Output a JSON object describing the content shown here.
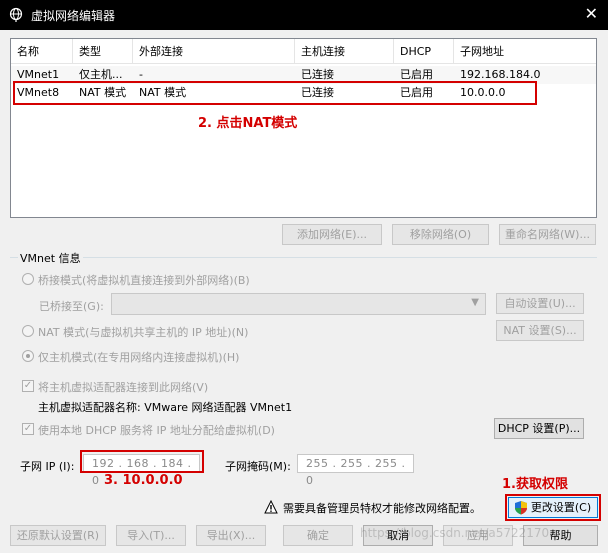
{
  "window": {
    "title": "虚拟网络编辑器",
    "close_glyph": "✕"
  },
  "table": {
    "columns": [
      "名称",
      "类型",
      "外部连接",
      "主机连接",
      "DHCP",
      "子网地址"
    ],
    "rows": [
      [
        "VMnet1",
        "仅主机...",
        "-",
        "已连接",
        "已启用",
        "192.168.184.0"
      ],
      [
        "VMnet8",
        "NAT 模式",
        "NAT 模式",
        "已连接",
        "已启用",
        "10.0.0.0"
      ]
    ]
  },
  "table_buttons": {
    "add": "添加网络(E)...",
    "remove": "移除网络(O)",
    "rename": "重命名网络(W)..."
  },
  "vmnet_info": {
    "title": "VMnet 信息",
    "bridged_label": "桥接模式(将虚拟机直接连接到外部网络)(B)",
    "bridged_to_label": "已桥接至(G):",
    "auto_settings": "自动设置(U)...",
    "nat_label": "NAT 模式(与虚拟机共享主机的 IP 地址)(N)",
    "nat_settings": "NAT 设置(S)...",
    "hostonly_label": "仅主机模式(在专用网络内连接虚拟机)(H)",
    "connect_adapter_label": "将主机虚拟适配器连接到此网络(V)",
    "adapter_name_label": "主机虚拟适配器名称: VMware 网络适配器 VMnet1",
    "dhcp_label": "使用本地 DHCP 服务将 IP 地址分配给虚拟机(D)",
    "dhcp_settings": "DHCP 设置(P)...",
    "subnet_ip_label": "子网 IP (I):",
    "subnet_ip_value": "192 . 168 . 184 . 0",
    "subnet_mask_label": "子网掩码(M):",
    "subnet_mask_value": "255 . 255 . 255 . 0"
  },
  "admin_notice": "需要具备管理员特权才能修改网络配置。",
  "change_settings": "更改设置(C)",
  "footer": {
    "restore": "还原默认设置(R)",
    "import": "导入(T)...",
    "export": "导出(X)...",
    "ok": "确定",
    "cancel": "取消",
    "apply": "应用",
    "help": "帮助"
  },
  "annotations": {
    "step1": "1.获取权限",
    "step2": "2. 点击NAT模式",
    "step3": "3.     10.0.0.0"
  },
  "watermark": "https://blog.csdn.net/a5722170",
  "colors": {
    "annotation_red": "#d40000",
    "titlebar_bg": "#000000"
  },
  "icons": {
    "app": "network-globe-icon",
    "warning": "warning-triangle-icon",
    "shield": "uac-shield-icon",
    "dropdown": "chevron-down-icon"
  }
}
